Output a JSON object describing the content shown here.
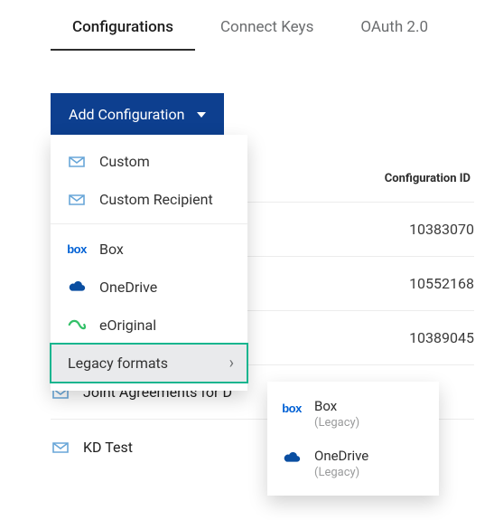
{
  "tabs": {
    "configurations": "Configurations",
    "connect_keys": "Connect Keys",
    "oauth": "OAuth 2.0"
  },
  "add_button": {
    "label": "Add Configuration"
  },
  "menu": {
    "custom": "Custom",
    "custom_recipient": "Custom Recipient",
    "box": "Box",
    "onedrive": "OneDrive",
    "eoriginal": "eOriginal",
    "legacy": "Legacy formats"
  },
  "submenu": {
    "box": {
      "name": "Box",
      "sub": "(Legacy)"
    },
    "onedrive": {
      "name": "OneDrive",
      "sub": "(Legacy)"
    }
  },
  "table": {
    "header_config_id": "Configuration ID",
    "rows": [
      {
        "name": "",
        "id": "10383070"
      },
      {
        "name": "",
        "id": "10552168"
      },
      {
        "name": "",
        "id": "10389045"
      },
      {
        "name": "Joint Agreements for D",
        "id": ""
      },
      {
        "name": "KD Test",
        "id": ""
      }
    ]
  }
}
